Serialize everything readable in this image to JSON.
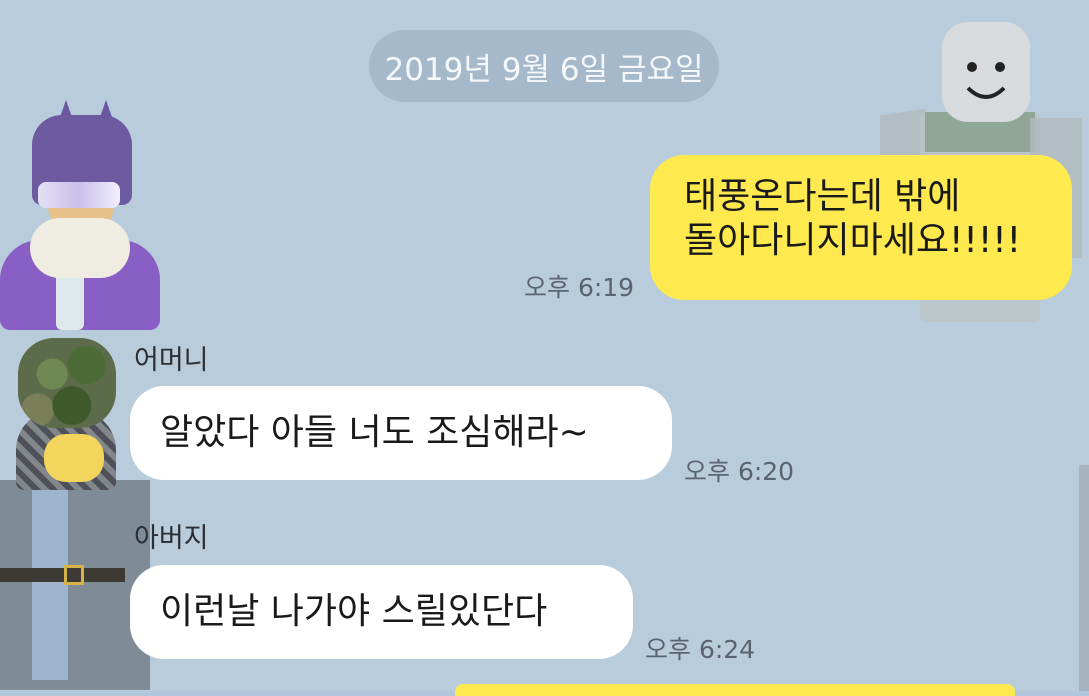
{
  "date_divider": "2019년 9월 6일 금요일",
  "messages": [
    {
      "direction": "sent",
      "lines": [
        "태풍온다는데 밖에",
        "돌아다니지마세요!!!!!"
      ],
      "time": "오후 6:19"
    },
    {
      "direction": "received",
      "sender": "어머니",
      "text": "알았다 아들 너도 조심해라~",
      "time": "오후 6:20"
    },
    {
      "direction": "received",
      "sender": "아버지",
      "text": "이런날 나가야 스릴있단다",
      "time": "오후 6:24"
    }
  ],
  "colors": {
    "background": "#b9ccdb",
    "sent_bubble": "#fee94e",
    "received_bubble": "#ffffff"
  }
}
